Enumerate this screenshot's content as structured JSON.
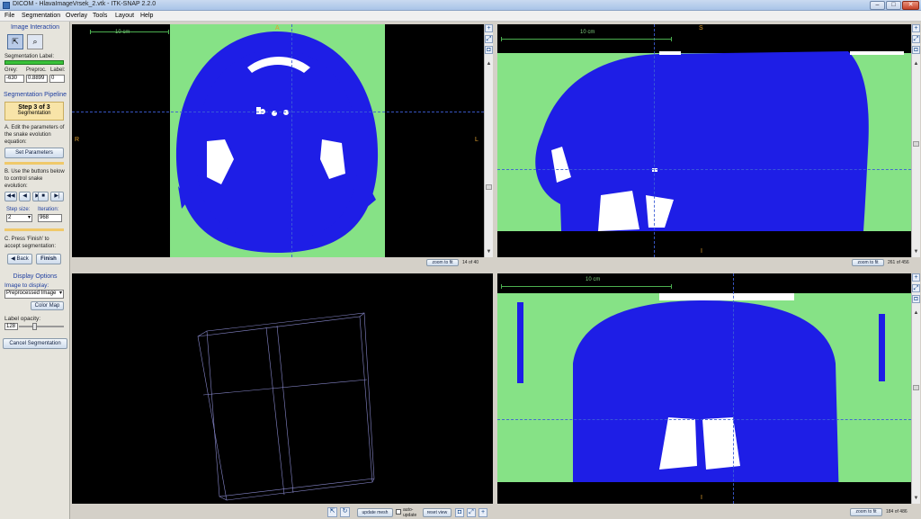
{
  "window": {
    "title": "DICOM - HlavaImageVrsek_2.vtk - ITK-SNAP 2.2.0",
    "min": "–",
    "max": "□",
    "close": "✕"
  },
  "menu": [
    "File",
    "Segmentation",
    "Overlay",
    "Tools",
    "Layout",
    "Help"
  ],
  "left": {
    "image_interaction": "Image Interaction",
    "seg_label": "Segmentation Label:",
    "grey_label": "Grey:",
    "grey_value": "-630",
    "preproc_label": "Preproc.",
    "preproc_value": "0.8899",
    "label_label": "Label:",
    "label_value": "0",
    "pipeline": "Segmentation Pipeline",
    "step": "Step 3 of 3",
    "step_name": "Segmentation",
    "edit_text": "A. Edit the parameters of the snake evolution equation:",
    "set_params": "Set Parameters",
    "buttons_text": "B. Use the buttons below to control snake evolution:",
    "rewind": "◀◀",
    "back_step": "◀",
    "play": "▶",
    "stop": "■",
    "step_fwd": "▶|",
    "step_size_label": "Step size:",
    "step_size_value": "2",
    "iteration_label": "Iteration:",
    "iteration_value": "968",
    "finish_text": "C. Press 'Finish' to accept segmentation:",
    "back": "Back",
    "finish": "Finish",
    "display_options": "Display Options",
    "image_to_display": "Image to display:",
    "image_select": "Preprocessed Image",
    "color_map": "Color Map",
    "label_opacity": "Label opacity:",
    "opacity_value": "128",
    "cancel": "Cancel Segmentation"
  },
  "views": {
    "axial": {
      "scale": "10 cm",
      "top": "A",
      "left": "R",
      "right": "L",
      "zoom": "zoom to fit",
      "slice": "14 of 40"
    },
    "sagittal": {
      "scale": "10 cm",
      "top": "S",
      "bottom": "I",
      "zoom": "zoom to fit",
      "slice": "261 of 456"
    },
    "view3d": {
      "update_mesh": "update mesh",
      "auto_update": "auto-update",
      "reset_view": "reset view"
    },
    "coronal": {
      "scale": "10 cm",
      "top": "S",
      "bottom": "I",
      "zoom": "zoom to fit",
      "slice": "184 of 486"
    }
  },
  "colors": {
    "segmentation": "#1e1ee6",
    "background_label": "#86e286",
    "bone": "#ffffff"
  }
}
